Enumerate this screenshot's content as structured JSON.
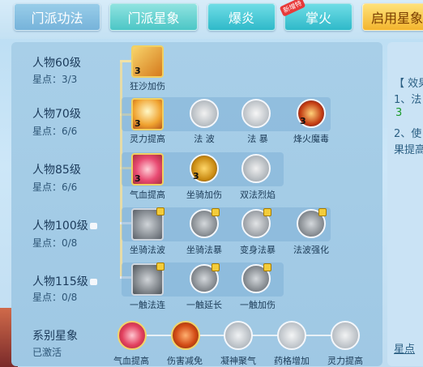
{
  "tabs": [
    {
      "label": "门派功法"
    },
    {
      "label": "门派星象"
    },
    {
      "label": "爆炎"
    },
    {
      "label": "掌火",
      "badge": "新增特"
    },
    {
      "label": "启用星象"
    }
  ],
  "rows": [
    {
      "title": "人物60级",
      "stars": "星点：3/3"
    },
    {
      "title": "人物70级",
      "stars": "星点：6/6"
    },
    {
      "title": "人物85级",
      "stars": "星点：6/6"
    },
    {
      "title": "人物100级",
      "stars": "星点：0/8"
    },
    {
      "title": "人物115级",
      "stars": "星点：0/8"
    },
    {
      "title": "系别星象",
      "stars": "已激活"
    }
  ],
  "icons": {
    "r1": [
      {
        "label": "狂沙加伤",
        "num": "3"
      }
    ],
    "r2": [
      {
        "label": "灵力提高",
        "num": "3"
      },
      {
        "label": "法 波"
      },
      {
        "label": "法 暴"
      },
      {
        "label": "烽火魔毒",
        "num": "3"
      }
    ],
    "r3": [
      {
        "label": "气血提高",
        "num": "3"
      },
      {
        "label": "坐骑加伤",
        "num": "3"
      },
      {
        "label": "双法烈焰"
      }
    ],
    "r4": [
      {
        "label": "坐骑法波"
      },
      {
        "label": "坐骑法暴"
      },
      {
        "label": "变身法暴"
      },
      {
        "label": "法波强化"
      }
    ],
    "r5": [
      {
        "label": "一触法连"
      },
      {
        "label": "一触延长"
      },
      {
        "label": "一触加伤"
      }
    ],
    "r6": [
      {
        "label": "气血提高"
      },
      {
        "label": "伤害减免"
      },
      {
        "label": "凝神聚气"
      },
      {
        "label": "药格增加"
      },
      {
        "label": "灵力提高"
      }
    ]
  },
  "right": {
    "line1": "【 效果",
    "line2": "1、法",
    "line3": "3",
    "line4": "2、使",
    "line5": "果提高",
    "bottom": "星点"
  },
  "colors": {
    "accent_gold": "#f0d062",
    "panel_blue": "#a8cfe8",
    "green": "#1a9a2a"
  }
}
